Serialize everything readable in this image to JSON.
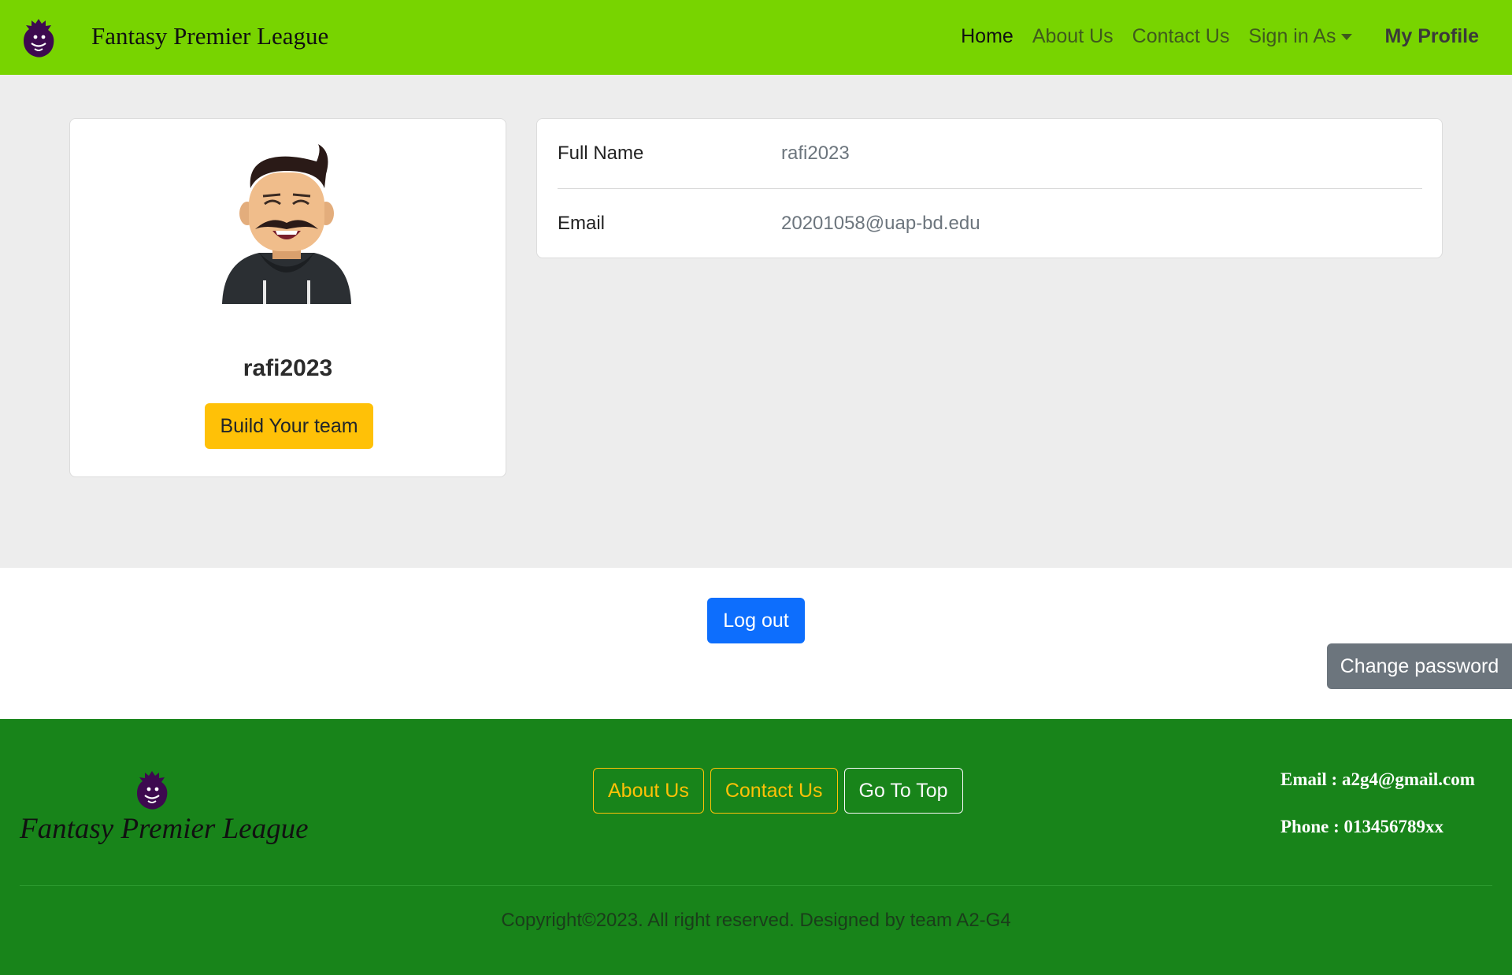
{
  "navbar": {
    "brand": "Fantasy Premier League",
    "logo_icon": "premier-league-lion-icon",
    "links": {
      "home": "Home",
      "about": "About Us",
      "contact": "Contact Us",
      "sign_in": "Sign in As",
      "profile": "My Profile"
    }
  },
  "profile": {
    "username": "rafi2023",
    "avatar_icon": "user-avatar-icon",
    "build_button": "Build Your team"
  },
  "info": {
    "full_name_label": "Full Name",
    "full_name_value": "rafi2023",
    "email_label": "Email",
    "email_value": "20201058@uap-bd.edu"
  },
  "actions": {
    "logout": "Log out",
    "change_password": "Change password"
  },
  "footer": {
    "brand": "Fantasy Premier League",
    "about": "About Us",
    "contact": "Contact Us",
    "top": "Go To Top",
    "email": "Email : a2g4@gmail.com",
    "phone": "Phone : 013456789xx",
    "copyright": "Copyright©2023. All right reserved. Designed by team A2-G4"
  },
  "colors": {
    "navbar": "#78d400",
    "footer": "#18841a",
    "warning": "#ffc107",
    "primary": "#0d6efd",
    "secondary": "#6c757d"
  }
}
